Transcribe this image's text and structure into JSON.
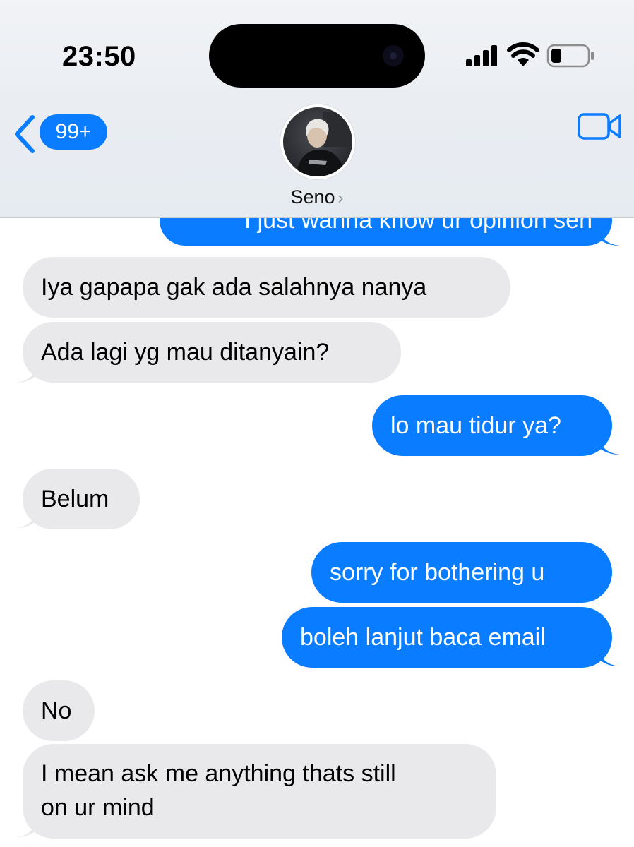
{
  "status_bar": {
    "time": "23:50"
  },
  "header": {
    "back_badge": "99+",
    "contact_name": "Seno",
    "name_chevron": "›"
  },
  "colors": {
    "sent_bubble": "#0a7cff",
    "received_bubble": "#e9e9eb",
    "header_bg": "#eaeef3"
  },
  "icons": {
    "back": "chevron-left-icon",
    "video": "video-camera-icon",
    "signal": "cellular-signal-icon",
    "wifi": "wifi-icon",
    "battery": "battery-icon"
  },
  "messages": [
    {
      "direction": "sent",
      "text": "I just wanna know ur opinion sen"
    },
    {
      "direction": "received",
      "text": "Iya gapapa gak ada salahnya nanya"
    },
    {
      "direction": "received",
      "text": "Ada lagi yg mau ditanyain?"
    },
    {
      "direction": "sent",
      "text": "lo mau tidur ya?"
    },
    {
      "direction": "received",
      "text": "Belum"
    },
    {
      "direction": "sent",
      "text": "sorry for bothering u"
    },
    {
      "direction": "sent",
      "text": "boleh lanjut baca email"
    },
    {
      "direction": "received",
      "text": "No"
    },
    {
      "direction": "received",
      "line1": "I mean ask me anything thats still",
      "line2": "on ur mind"
    }
  ]
}
